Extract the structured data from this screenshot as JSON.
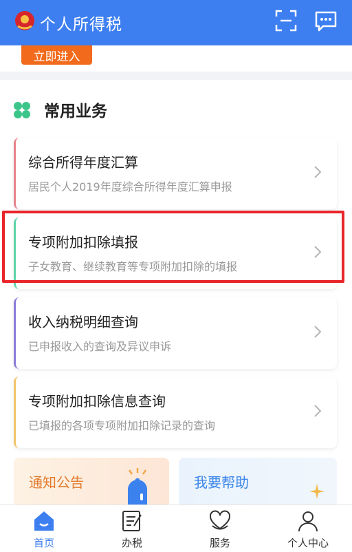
{
  "header": {
    "title": "个人所得税",
    "emblem_icon": "tax-emblem-icon",
    "scan_icon": "scan-icon",
    "message_icon": "message-icon",
    "background_color": "#3d7ff0"
  },
  "banner": {
    "enter_label": "立即进入",
    "enter_color": "#f26b1d"
  },
  "services": {
    "title": "常用业务",
    "items": [
      {
        "title": "综合所得年度汇算",
        "subtitle": "居民个人2019年度综合所得年度汇算申报",
        "accent": "#e8848c"
      },
      {
        "title": "专项附加扣除填报",
        "subtitle": "子女教育、继续教育等专项附加扣除的填报",
        "accent": "#5fd4a8",
        "highlighted": true
      },
      {
        "title": "收入纳税明细查询",
        "subtitle": "已申报收入的查询及异议申诉",
        "accent": "#8b7ad9"
      },
      {
        "title": "专项附加扣除信息查询",
        "subtitle": "已填报的各项专项附加扣除记录的查询",
        "accent": "#f2c46a"
      }
    ]
  },
  "tiles": {
    "notice": "通知公告",
    "help": "我要帮助"
  },
  "tabbar": {
    "items": [
      {
        "label": "首页",
        "icon": "home-icon",
        "active": true
      },
      {
        "label": "办税",
        "icon": "tax-form-icon"
      },
      {
        "label": "服务",
        "icon": "service-heart-icon"
      },
      {
        "label": "个人中心",
        "icon": "person-icon"
      }
    ],
    "active_color": "#3d7ff0"
  }
}
